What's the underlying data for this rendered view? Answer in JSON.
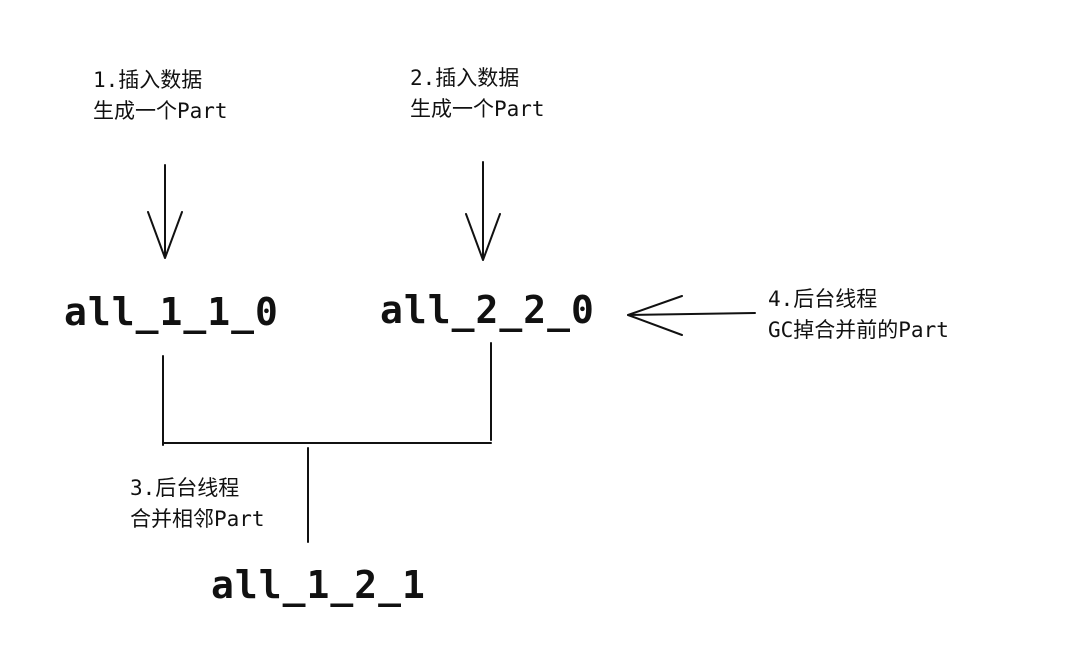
{
  "step1": {
    "line1": "1.插入数据",
    "line2": "生成一个Part"
  },
  "step2": {
    "line1": "2.插入数据",
    "line2": "生成一个Part"
  },
  "step3": {
    "line1": "3.后台线程",
    "line2": "合并相邻Part"
  },
  "step4": {
    "line1": "4.后台线程",
    "line2": "GC掉合并前的Part"
  },
  "parts": {
    "part_a": "all_1_1_0",
    "part_b": "all_2_2_0",
    "merged": "all_1_2_1"
  },
  "colors": {
    "ink": "#111111",
    "background": "#ffffff"
  }
}
